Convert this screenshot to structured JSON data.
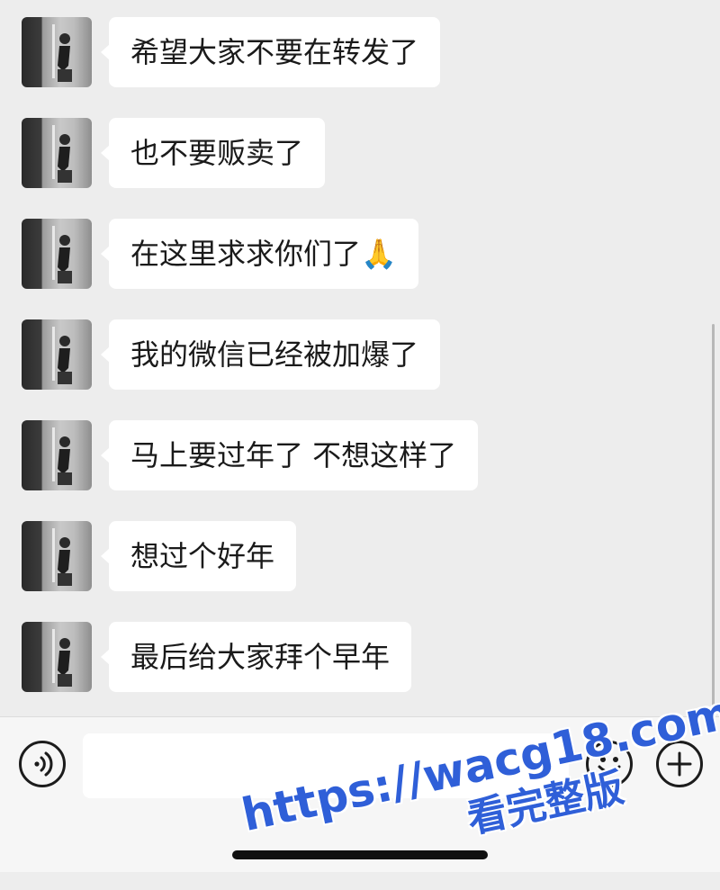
{
  "messages": [
    {
      "text": "希望大家不要在转发了"
    },
    {
      "text": "也不要贩卖了"
    },
    {
      "text": "在这里求求你们了🙏"
    },
    {
      "text": "我的微信已经被加爆了"
    },
    {
      "text": "马上要过年了 不想这样了"
    },
    {
      "text": "想过个好年"
    },
    {
      "text": "最后给大家拜个早年"
    }
  ],
  "input_bar": {
    "voice_icon": "voice-icon",
    "emoji_icon": "smiley-icon",
    "plus_icon": "plus-icon",
    "value": ""
  },
  "watermark": {
    "url": "https://wacg18.com",
    "subtitle": "看完整版"
  },
  "colors": {
    "background": "#ededed",
    "bubble": "#ffffff",
    "watermark": "#2f5fd8"
  }
}
